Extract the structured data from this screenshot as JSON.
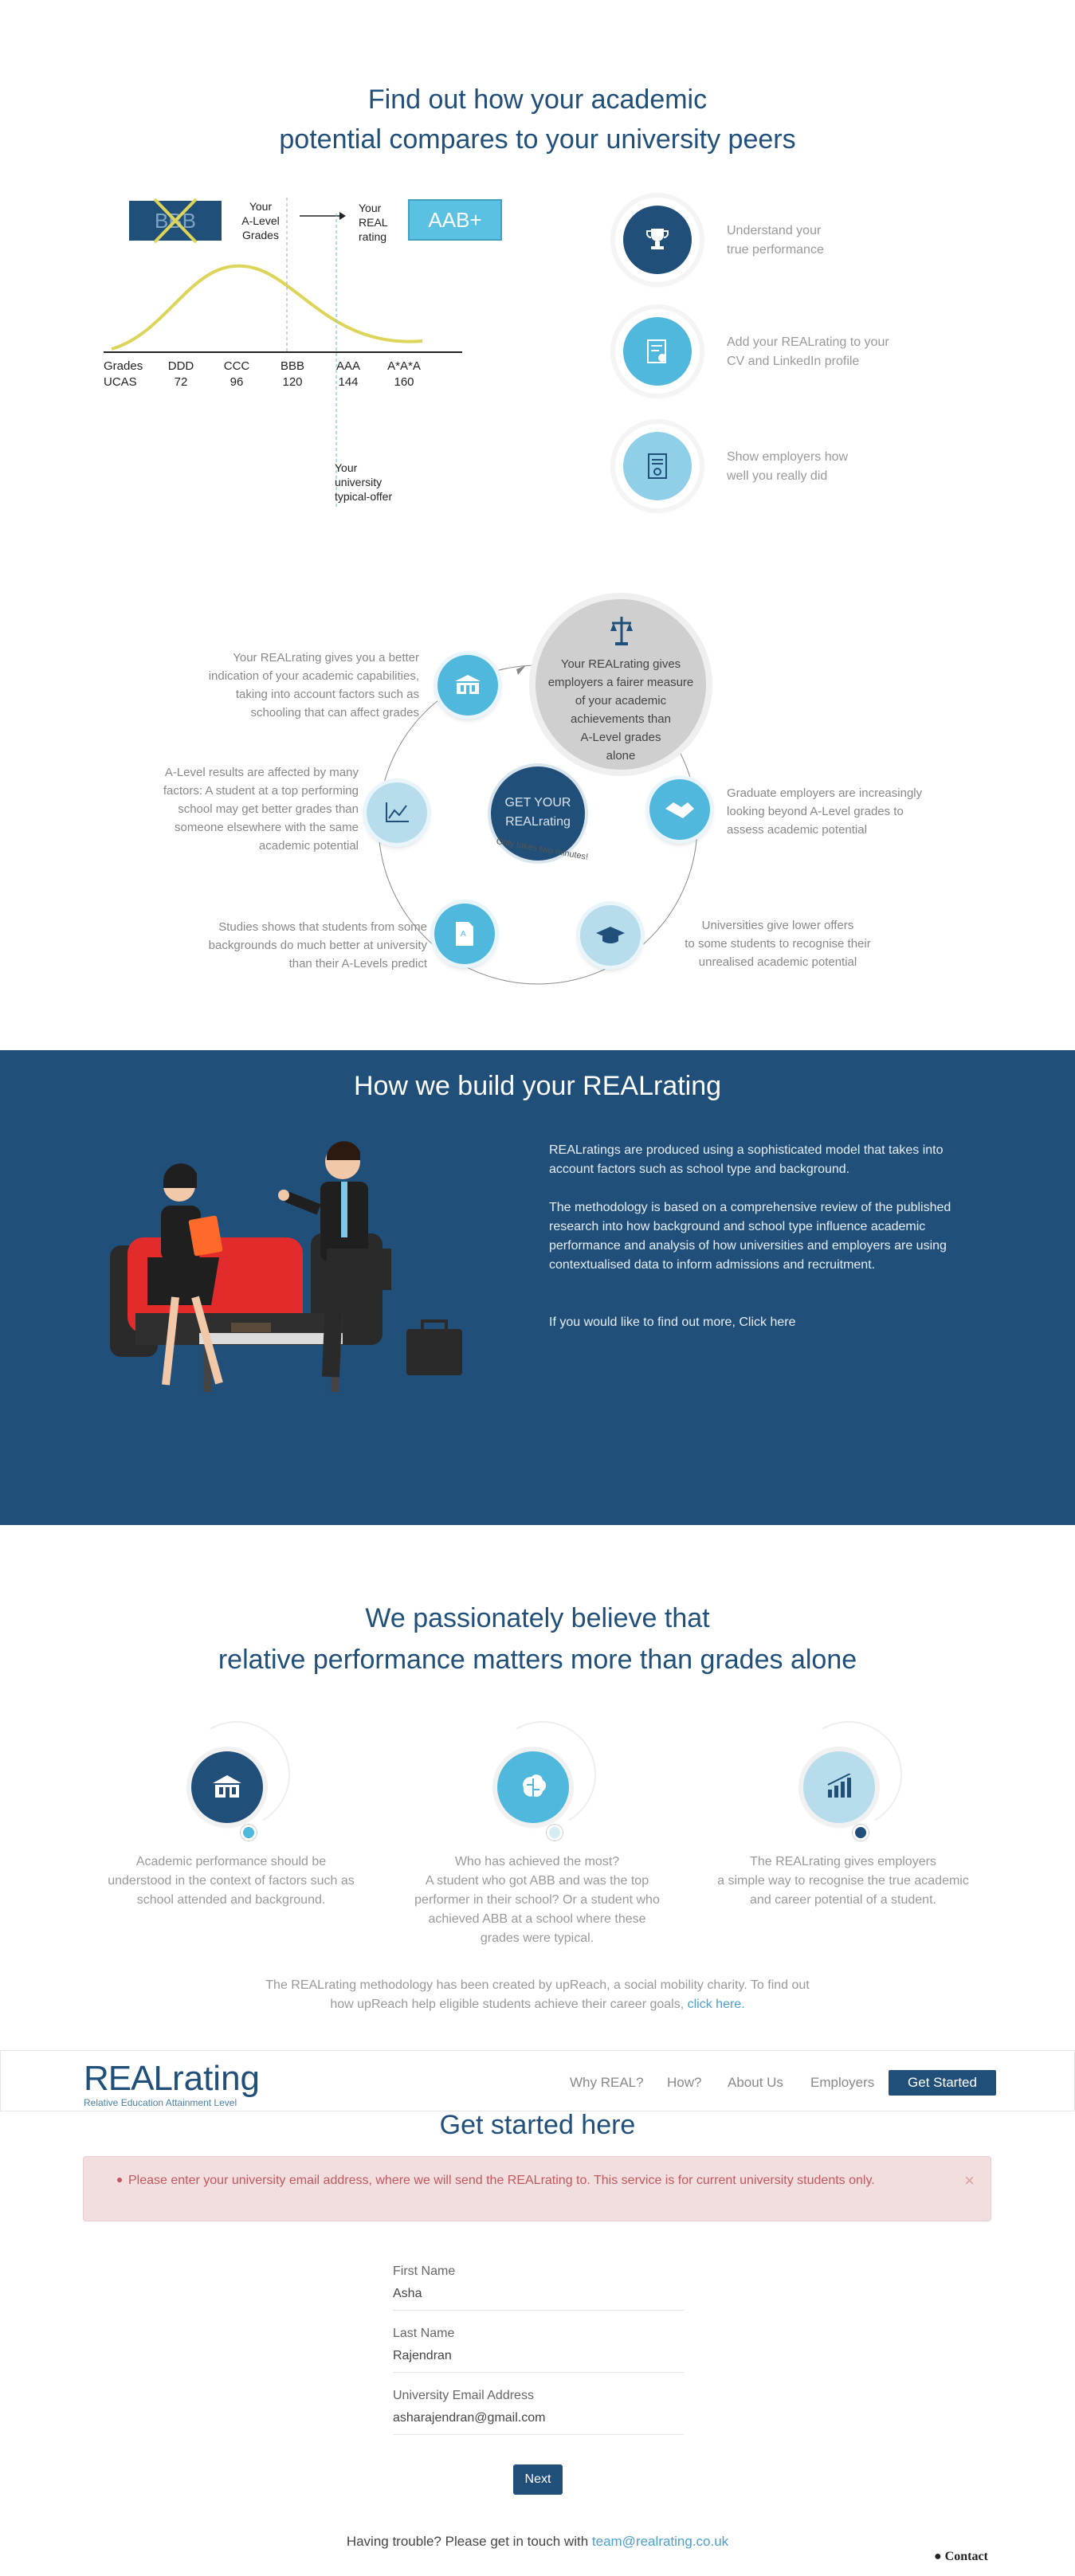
{
  "section1": {
    "title_line1": "Find out how your academic",
    "title_line2": "potential compares to your university peers",
    "diagram": {
      "crossed_grade": "BBB",
      "your_alevel_label_1": "Your",
      "your_alevel_label_2": "A-Level",
      "your_alevel_label_3": "Grades",
      "your_real_label_1": "Your",
      "your_real_label_2": "REAL",
      "your_real_label_3": "rating",
      "real_grade": "AAB+",
      "row_label_grades": "Grades",
      "row_label_ucas": "UCAS",
      "grades": [
        "DDD",
        "CCC",
        "BBB",
        "AAA",
        "A*A*A"
      ],
      "ucas": [
        "72",
        "96",
        "120",
        "144",
        "160"
      ],
      "offer_label_1": "Your",
      "offer_label_2": "university",
      "offer_label_3": "typical-offer"
    },
    "features": [
      {
        "line1": "Understand your",
        "line2": "true performance",
        "icon": "trophy-icon"
      },
      {
        "line1": "Add your REALrating to your",
        "line2": "CV and LinkedIn profile",
        "icon": "certificate-icon"
      },
      {
        "line1": "Show employers how",
        "line2": "well you really did",
        "icon": "document-icon"
      }
    ]
  },
  "section2": {
    "center_button_1": "GET YOUR",
    "center_button_2": "REALrating",
    "center_note": "Only takes two minutes!",
    "big_circle": [
      "Your REALrating gives",
      "employers a fairer measure",
      "of your academic",
      "achievements than",
      "A-Level grades",
      "alone"
    ],
    "texts": {
      "top_left": [
        "Your REALrating gives you a better",
        "indication of your academic capabilities,",
        "taking into account factors such as",
        "schooling that can affect grades"
      ],
      "mid_left": [
        "A-Level results are affected by many",
        "factors: A student at a top performing",
        "school may get better grades than",
        "someone elsewhere with the same",
        "academic potential"
      ],
      "bottom_left": [
        "Studies shows that students from some",
        "backgrounds do much better at university",
        "than their A-Levels predict"
      ],
      "mid_right": [
        "Graduate employers are increasingly",
        "looking beyond A-Level grades to",
        "assess academic potential"
      ],
      "bottom_right": [
        "Universities give lower offers",
        "to some students to recognise their",
        "unrealised academic potential"
      ]
    }
  },
  "section3": {
    "title": "How we build your REALrating",
    "p1": "REALratings are produced using a sophisticated model that takes into account factors such as school type and background.",
    "p2": "The methodology is based on a comprehensive review of the published research into how background and school type influence academic performance and analysis of how universities and employers are using contextualised data to inform admissions and recruitment.",
    "p3": "If you would like to find out more, Click here"
  },
  "section4": {
    "title_line1": "We passionately believe that",
    "title_line2": "relative performance matters more than grades alone",
    "beliefs": [
      {
        "lines": [
          "Academic performance should be",
          "understood in the context of factors such as",
          "school attended and background."
        ],
        "icon": "school-icon"
      },
      {
        "lines": [
          "Who has achieved the most?",
          "A student who got ABB and was the top",
          "performer in their school? Or a student who",
          "achieved ABB at a school where these",
          "grades were typical."
        ],
        "icon": "brain-icon"
      },
      {
        "lines": [
          "The REALrating gives employers",
          "a simple way to recognise the true academic",
          "and career potential of a student."
        ],
        "icon": "bar-chart-icon"
      }
    ],
    "note_line1": "The REALrating methodology has been created by upReach, a social mobility charity. To find out",
    "note_line2_prefix": "how upReach help eligible students achieve their career goals, ",
    "note_link": "click here."
  },
  "nav": {
    "logo_real": "REAL",
    "logo_rating": "rating",
    "logo_tagline": "Relative Education Attainment Level",
    "links": [
      "Why REAL?",
      "How?",
      "About Us",
      "Employers"
    ],
    "cta": "Get Started"
  },
  "form": {
    "title": "Get started here",
    "alert": "Please enter your university email address, where we will send the REALrating to. This service is for current university students only.",
    "alert_close": "×",
    "first_name_label": "First Name",
    "first_name_value": "Asha",
    "last_name_label": "Last Name",
    "last_name_value": "Rajendran",
    "email_label": "University Email Address",
    "email_value": "asharajendran@gmail.com",
    "next": "Next",
    "trouble_prefix": "Having trouble? Please get in touch with ",
    "trouble_email": "team@realrating.co.uk",
    "contact": "Contact"
  }
}
